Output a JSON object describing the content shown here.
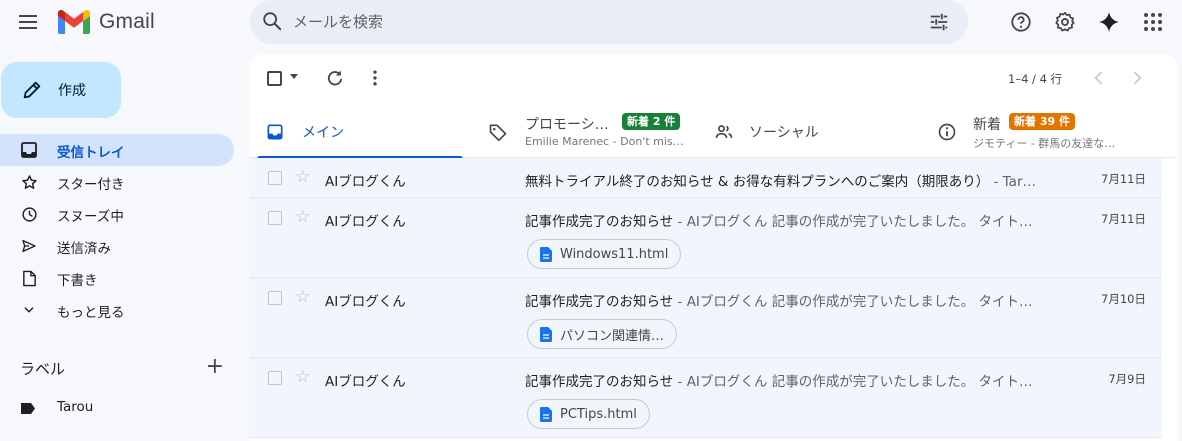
{
  "app": {
    "name": "Gmail"
  },
  "search": {
    "placeholder": "メールを検索"
  },
  "compose": {
    "label": "作成"
  },
  "nav": [
    {
      "label": "受信トレイ",
      "icon": "inbox-icon",
      "active": true
    },
    {
      "label": "スター付き",
      "icon": "star-icon"
    },
    {
      "label": "スヌーズ中",
      "icon": "clock-icon"
    },
    {
      "label": "送信済み",
      "icon": "send-icon"
    },
    {
      "label": "下書き",
      "icon": "draft-icon"
    },
    {
      "label": "もっと見る",
      "icon": "chevron-down-icon"
    }
  ],
  "labels": {
    "title": "ラベル",
    "items": [
      {
        "name": "Tarou"
      }
    ]
  },
  "toolbar": {
    "pager": "1–4 / 4 行"
  },
  "tabs": {
    "main": {
      "label": "メイン"
    },
    "promotions": {
      "label": "プロモーシ…",
      "badge": "新着 2 件",
      "sub": "Emilie Marenec - Don't mis…"
    },
    "social": {
      "label": "ソーシャル"
    },
    "updates": {
      "label": "新着",
      "badge": "新着 39 件",
      "sub": "ジモティー - 群馬の友達な…"
    }
  },
  "emails": [
    {
      "sender": "AIブログくん",
      "subject": "無料トライアル終了のお知らせ & お得な有料プランへのご案内（期限あり）",
      "snippet": " - Tar…",
      "date": "7月11日"
    },
    {
      "sender": "AIブログくん",
      "subject": "記事作成完了のお知らせ",
      "snippet": " - AIブログくん 記事の作成が完了いたしました。 タイト…",
      "date": "7月11日",
      "attachment": "Windows11.html"
    },
    {
      "sender": "AIブログくん",
      "subject": "記事作成完了のお知らせ",
      "snippet": " - AIブログくん 記事の作成が完了いたしました。 タイト…",
      "date": "7月10日",
      "attachment": "パソコン関連情…"
    },
    {
      "sender": "AIブログくん",
      "subject": "記事作成完了のお知らせ",
      "snippet": " - AIブログくん 記事の作成が完了いたしました。 タイト…",
      "date": "7月9日",
      "attachment": "PCTips.html"
    }
  ],
  "colors": {
    "accent": "#0b57d0",
    "compose_bg": "#c2e7ff",
    "nav_active_bg": "#d3e3fd",
    "promotions_badge": "#188038",
    "updates_badge": "#e37400",
    "doc_icon": "#1a73e8"
  }
}
